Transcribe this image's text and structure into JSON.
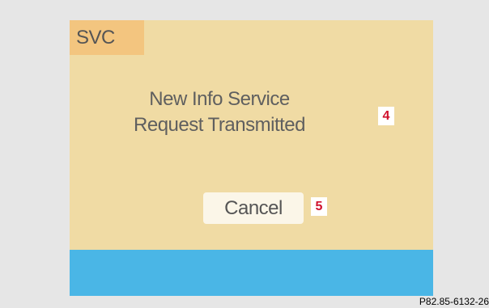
{
  "screen": {
    "tab_label": "SVC",
    "message_lines": [
      "New Info Service",
      "Request Transmitted"
    ],
    "cancel_label": "Cancel",
    "colors": {
      "background": "#f0dba4",
      "tab": "#f3c57f",
      "bottom_bar": "#4ab6e6",
      "text": "#5f5f5f"
    }
  },
  "callouts": {
    "message": "4",
    "cancel": "5",
    "color": "#d0102c"
  },
  "figure_id": "P82.85-6132-26"
}
